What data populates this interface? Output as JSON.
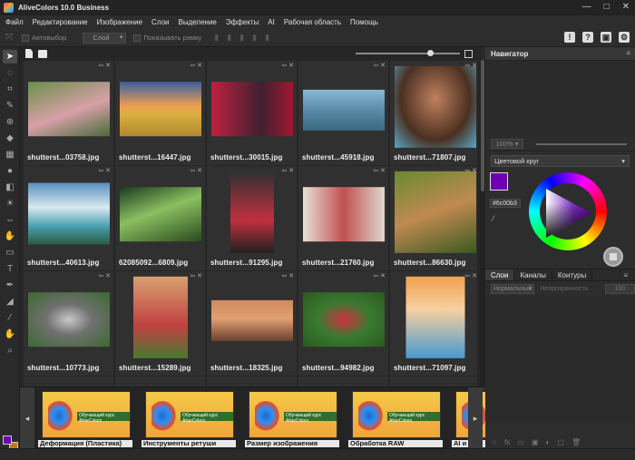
{
  "app": {
    "title": "AliveColors 10.0 Business"
  },
  "window_controls": {
    "minimize": "—",
    "maximize": "□",
    "close": "✕"
  },
  "menu": [
    "Файл",
    "Редактирование",
    "Изображение",
    "Слои",
    "Выделение",
    "Эффекты",
    "AI",
    "Рабочая область",
    "Помощь"
  ],
  "options_bar": {
    "autoselect_label": "Автовыбор",
    "layer_select_value": "Слой",
    "show_frame_label": "Показывать рамку",
    "right_icons": [
      "!",
      "?",
      "▣",
      "⚙"
    ]
  },
  "toolbox": {
    "tools": [
      "move-tool",
      "lasso-tool",
      "crop-tool",
      "brush-tool",
      "clone-tool",
      "fill-tool",
      "gradient-tool",
      "blur-tool",
      "eraser-tool",
      "dodge-tool",
      "transform-tool",
      "smudge-tool",
      "shape-tool",
      "text-tool",
      "pen-tool",
      "selection-tool",
      "eyedropper-tool",
      "hand-tool",
      "zoom-tool"
    ],
    "tool_glyphs": [
      "➤",
      "◌",
      "⌗",
      "✎",
      "⊕",
      "◆",
      "▦",
      "●",
      "◧",
      "☀",
      "⇔",
      "✋",
      "▭",
      "T",
      "✒",
      "◢",
      "⁄",
      "✋",
      "⌕"
    ],
    "foreground": "#6c00b3",
    "background": "#b87c1a"
  },
  "browser": {
    "tag": "⇦ ✕",
    "files": [
      "shutterst...03758.jpg",
      "shutterst...16447.jpg",
      "shutterst...30015.jpg",
      "shutterst...45918.jpg",
      "shutterst...71807.jpg",
      "shutterst...40613.jpg",
      "62085092...6809.jpg",
      "shutterst...91295.jpg",
      "shutterst...21760.jpg",
      "shutterst...86630.jpg",
      "shutterst...10773.jpg",
      "shutterst...15289.jpg",
      "shutterst...18325.jpg",
      "shutterst...94982.jpg",
      "shutterst...71097.jpg"
    ]
  },
  "strip": {
    "prev": "◂",
    "next": "▸",
    "banner_text": "Обучающий курс AliveColors",
    "items": [
      "Деформация (Пластика)",
      "Инструменты ретуши",
      "Размер изображения",
      "Обработка RAW",
      "AI и"
    ]
  },
  "navigator": {
    "title": "Навигатор",
    "menu": "≡",
    "zoom": "100% ▾"
  },
  "color": {
    "mode": "Цветовой круг",
    "hex": "#6c00b3"
  },
  "layers": {
    "tabs": [
      "Слои",
      "Каналы",
      "Контуры"
    ],
    "menu": "≡",
    "blend_mode": "Нормальный",
    "opacity_label": "Непрозрачность",
    "opacity_value": "100",
    "footer_icons": [
      "☆",
      "fx",
      "▭",
      "▣",
      "◐",
      "▢",
      "🗑"
    ]
  }
}
